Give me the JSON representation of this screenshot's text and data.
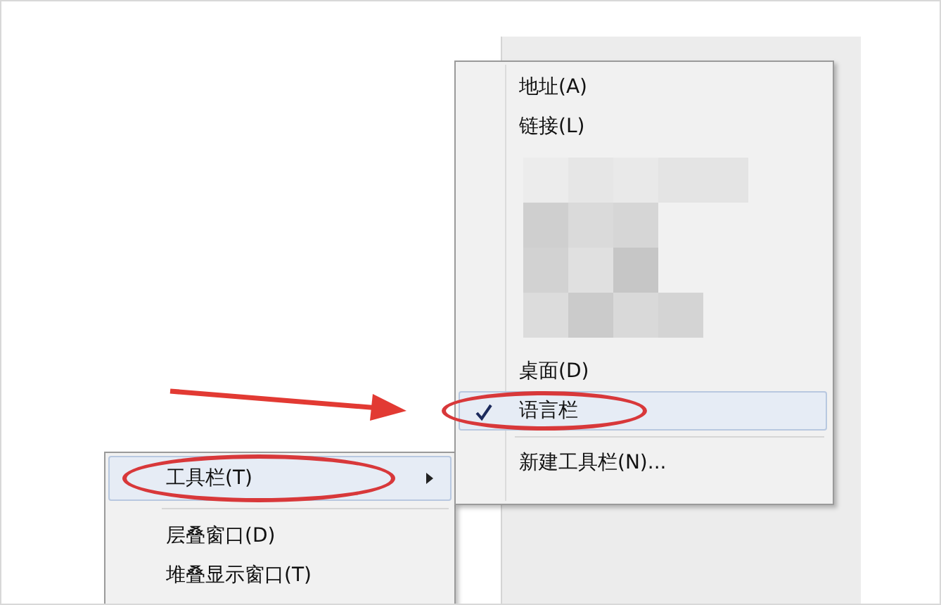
{
  "pointer_arrow": true,
  "context_menu": {
    "items": [
      {
        "kind": "item",
        "label": "工具栏(T)",
        "selected": true,
        "has_submenu": true,
        "circled": true
      },
      {
        "kind": "separator"
      },
      {
        "kind": "item",
        "label": "层叠窗口(D)",
        "selected": false,
        "has_submenu": false,
        "circled": false
      },
      {
        "kind": "item",
        "label": "堆叠显示窗口(T)",
        "selected": false,
        "has_submenu": false,
        "circled": false
      }
    ]
  },
  "submenu": {
    "items": [
      {
        "kind": "item",
        "label": "地址(A)",
        "checked": false,
        "selected": false,
        "circled": false
      },
      {
        "kind": "item",
        "label": "链接(L)",
        "checked": false,
        "selected": false,
        "circled": false
      },
      {
        "kind": "mosaic"
      },
      {
        "kind": "item",
        "label": "桌面(D)",
        "checked": false,
        "selected": false,
        "circled": false
      },
      {
        "kind": "item",
        "label": "语言栏",
        "checked": true,
        "selected": true,
        "circled": true
      },
      {
        "kind": "separator"
      },
      {
        "kind": "item",
        "label": "新建工具栏(N)...",
        "checked": false,
        "selected": false,
        "circled": false
      }
    ]
  }
}
